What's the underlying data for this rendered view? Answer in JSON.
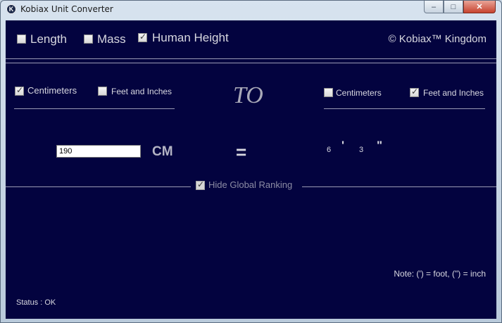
{
  "window": {
    "title": "Kobiax Unit Converter",
    "icon_glyph": "K",
    "controls": {
      "minimize": "–",
      "maximize": "□",
      "close": "✕"
    }
  },
  "categories": [
    {
      "label": "Length",
      "checked": false
    },
    {
      "label": "Mass",
      "checked": false
    },
    {
      "label": "Human Height",
      "checked": true
    }
  ],
  "brand": "© Kobiax™ Kingdom",
  "from_units": [
    {
      "label": "Centimeters",
      "checked": true
    },
    {
      "label": "Feet and Inches",
      "checked": false
    }
  ],
  "to_label": "TO",
  "to_units": [
    {
      "label": "Centimeters",
      "checked": false
    },
    {
      "label": "Feet and Inches",
      "checked": true
    }
  ],
  "input_value": "190",
  "input_unit": "CM",
  "equals": "=",
  "result": {
    "feet": "6",
    "feet_mark": "'",
    "inches": "3",
    "inches_mark": "\""
  },
  "ranking": {
    "label": "Hide Global Ranking",
    "checked": true
  },
  "note": "Note: (') = foot, (\") = inch",
  "status": "Status : OK",
  "colors": {
    "panel_bg": "#03033f",
    "text": "#d8d8e0",
    "to_text": "#a9a9b8"
  }
}
